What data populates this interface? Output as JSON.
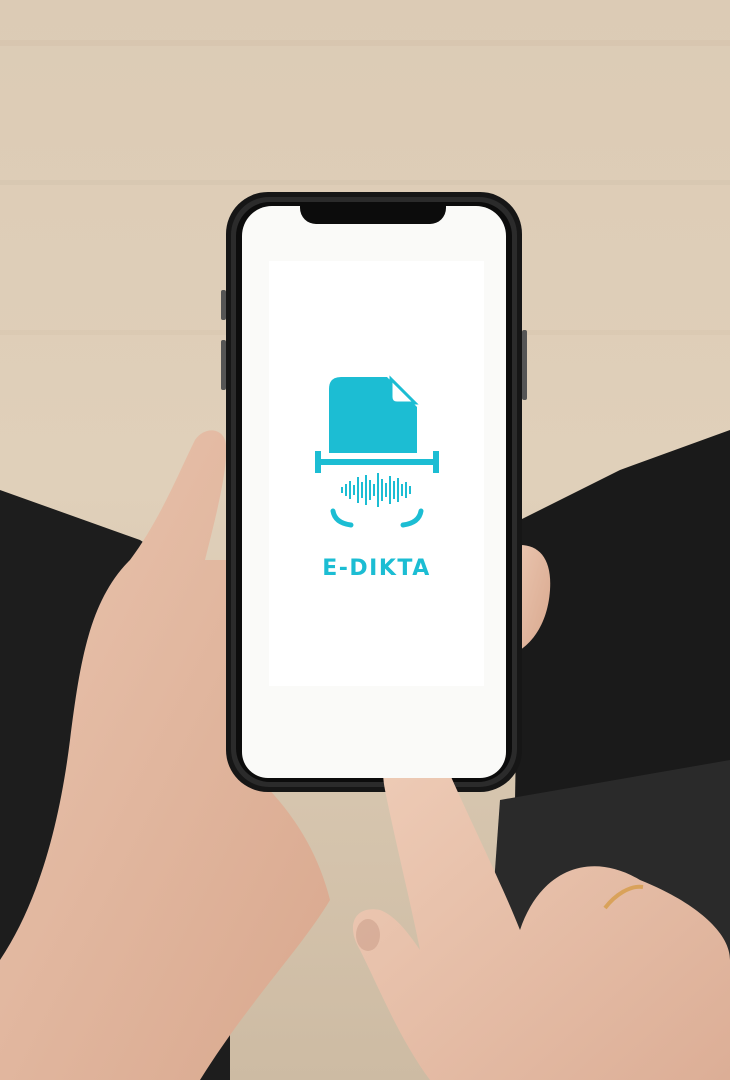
{
  "app": {
    "name": "E-DIKTA",
    "logo_icon": "document-soundwave-scan-icon",
    "accent_color": "#1cbdd3"
  },
  "scene": {
    "description_icons": [
      "phone-icon",
      "hand-icon"
    ]
  }
}
